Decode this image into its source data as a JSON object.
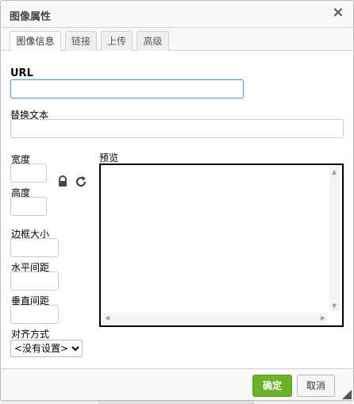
{
  "dialog": {
    "title": "图像属性",
    "close_icon": "×"
  },
  "tabs": [
    {
      "label": "图像信息",
      "active": true
    },
    {
      "label": "链接",
      "active": false
    },
    {
      "label": "上传",
      "active": false
    },
    {
      "label": "高级",
      "active": false
    }
  ],
  "form": {
    "url_label": "URL",
    "url_value": "",
    "alt_label": "替换文本",
    "alt_value": "",
    "width_label": "宽度",
    "width_value": "",
    "height_label": "高度",
    "height_value": "",
    "border_label": "边框大小",
    "border_value": "",
    "hspace_label": "水平间距",
    "hspace_value": "",
    "vspace_label": "垂直间距",
    "vspace_value": "",
    "align_label": "对齐方式",
    "align_selected": "<没有设置>",
    "preview_label": "预览"
  },
  "icons": {
    "lock": "lock-icon",
    "reset": "reset-size-icon"
  },
  "buttons": {
    "ok_label": "确定",
    "cancel_label": "取消"
  },
  "colors": {
    "ok_button": "#6bb12a",
    "focus_border": "#65a0d0"
  }
}
